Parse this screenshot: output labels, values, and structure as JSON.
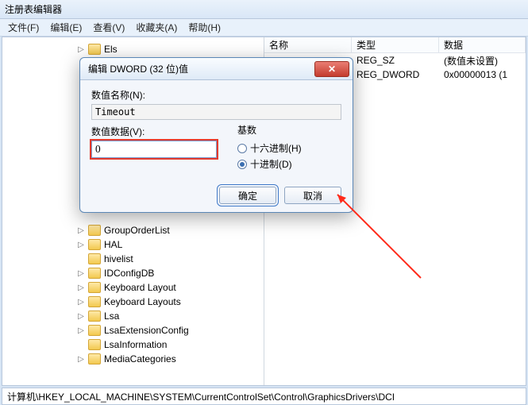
{
  "window": {
    "title": "注册表编辑器"
  },
  "menu": {
    "file": "文件(F)",
    "edit": "编辑(E)",
    "view": "查看(V)",
    "favorites": "收藏夹(A)",
    "help": "帮助(H)"
  },
  "tree": {
    "top": "Els",
    "items": [
      "GroupOrderList",
      "HAL",
      "hivelist",
      "IDConfigDB",
      "Keyboard Layout",
      "Keyboard Layouts",
      "Lsa",
      "LsaExtensionConfig",
      "LsaInformation",
      "MediaCategories"
    ]
  },
  "list": {
    "headers": {
      "name": "名称",
      "type": "类型",
      "data": "数据"
    },
    "rows": [
      {
        "name": "",
        "type": "REG_SZ",
        "data": "(数值未设置)"
      },
      {
        "name": "",
        "type": "REG_DWORD",
        "data": "0x00000013 (1"
      }
    ]
  },
  "dialog": {
    "title": "编辑 DWORD (32 位)值",
    "value_name_label": "数值名称(N):",
    "value_name": "Timeout",
    "value_data_label": "数值数据(V):",
    "value_data": "0",
    "base_label": "基数",
    "hex_label": "十六进制(H)",
    "dec_label": "十进制(D)",
    "ok": "确定",
    "cancel": "取消"
  },
  "statusbar": {
    "path": "计算机\\HKEY_LOCAL_MACHINE\\SYSTEM\\CurrentControlSet\\Control\\GraphicsDrivers\\DCI"
  }
}
